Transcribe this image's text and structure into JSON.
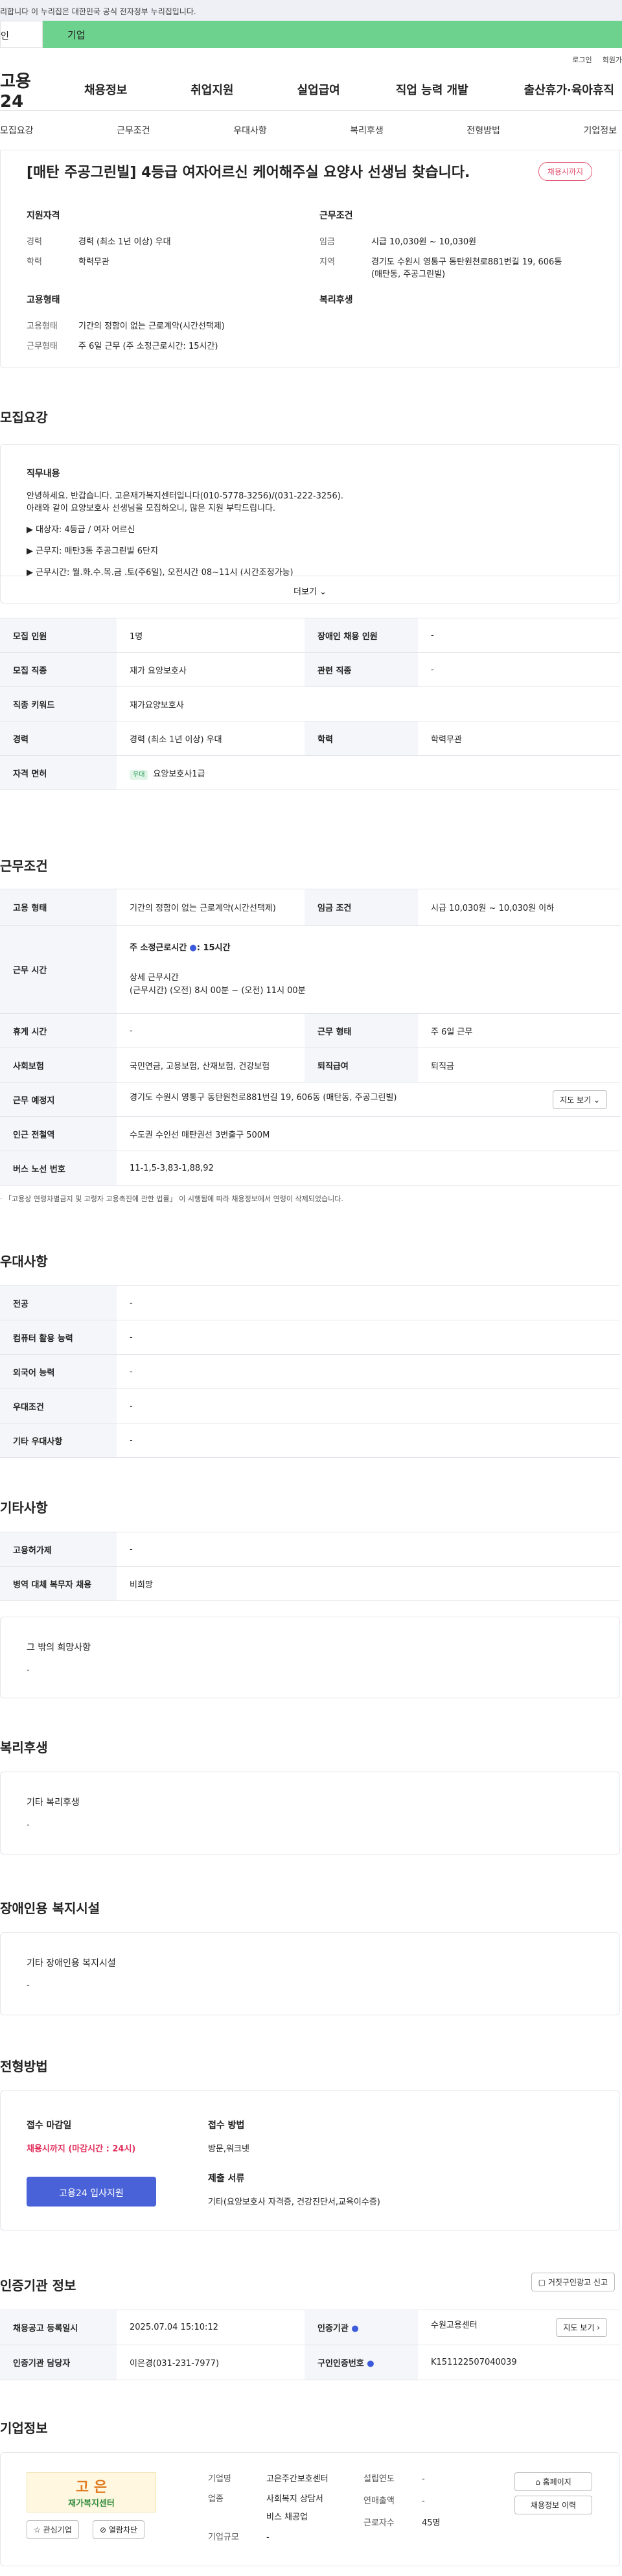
{
  "gov": "리합니다 이 누리집은 대한민국 공식 전자정부 누리집입니다.",
  "tabs": {
    "a": "인",
    "b": "기업"
  },
  "util": {
    "login": "로그인",
    "join": "회원가"
  },
  "logo": "고용24",
  "gnb": [
    "채용정보",
    "취업지원",
    "실업급여",
    "직업 능력 개발",
    "출산휴가·육아휴직"
  ],
  "snav": [
    "모집요강",
    "근무조건",
    "우대사항",
    "복리후생",
    "전형방법",
    "기업정보"
  ],
  "job": {
    "title": "[매탄 주공그린빌] 4등급 여자어르신 케어해주실 요양사 선생님 찾습니다.",
    "badge": "채용시까지",
    "qual_h": "지원자격",
    "exp_k": "경력",
    "exp_v": "경력 (최소 1년 이상) 우대",
    "edu_k": "학력",
    "edu_v": "학력무관",
    "cond_h": "근무조건",
    "wage_k": "임금",
    "wage_v": "시급 10,030원 ~ 10,030원",
    "area_k": "지역",
    "area_v1": "경기도 수원시 영통구 동탄원천로881번길 19, 606동",
    "area_v2": "(매탄동, 주공그린빌)",
    "emp_h": "고용형태",
    "type_k": "고용형태",
    "type_v": "기간의 정함이 없는 근로계약(시간선택제)",
    "form_k": "근무형태",
    "form_v": "주 6일 근무 (주 소정근로시간: 15시간)",
    "wel_h": "복리후생"
  },
  "s1": {
    "title": "모집요강",
    "duty_h": "직무내용",
    "l1": "안녕하세요. 반갑습니다.  고은재가복지센터입니다(010-5778-3256)/(031-222-3256).",
    "l2": "아래와 같이 요양보호사 선생님을 모집하오니, 많은 지원 부탁드립니다.",
    "l3": "▶ 대상자: 4등급 / 여자 어르신",
    "l4": "▶ 근무지: 매탄3동 주공그린빌 6단지",
    "l5": "▶ 근무시간: 월.화.수.목.금 .토(주6일), 오전시간 08~11시 (시간조정가능)",
    "more": "더보기",
    "cnt_k": "모집 인원",
    "cnt_v": "1명",
    "dis_k": "장애인 채용 인원",
    "dis_v": "-",
    "job_k": "모집 직종",
    "job_v": "재가 요양보호사",
    "rel_k": "관련 직종",
    "rel_v": "-",
    "kw_k": "직종 키워드",
    "kw_v": "재가요양보호사",
    "exp_k": "경력",
    "exp_v": "경력 (최소 1년 이상) 우대",
    "edu_k": "학력",
    "edu_v": "학력무관",
    "lic_k": "자격 면허",
    "lic_tag": "우대",
    "lic_v": "요양보호사1급"
  },
  "s2": {
    "title": "근무조건",
    "type_k": "고용 형태",
    "type_v": "기간의 정함이 없는 근로계약(시간선택제)",
    "wage_k": "임금 조건",
    "wage_v": "시급 10,030원 ~ 10,030원 이하",
    "time_k": "근무 시간",
    "time1": "주 소정근로시간",
    "time1b": ": 15시간",
    "time2": "상세 근무시간",
    "time3": "(근무시간) (오전) 8시 00분 ~ (오전) 11시 00분",
    "rest_k": "휴게 시간",
    "rest_v": "-",
    "form_k": "근무 형태",
    "form_v": "주 6일 근무",
    "ins_k": "사회보험",
    "ins_v": "국민연금, 고용보험, 산재보험, 건강보험",
    "ret_k": "퇴직급여",
    "ret_v": "퇴직금",
    "loc_k": "근무 예정지",
    "loc_v": "경기도 수원시 영통구 동탄원천로881번길 19, 606동 (매탄동, 주공그린빌)",
    "map": "지도 보기",
    "sub_k": "인근 전철역",
    "sub_v": "수도권 수인선 매탄권선 3번출구 500M",
    "bus_k": "버스 노선 번호",
    "bus_v": "11-1,5-3,83-1,88,92",
    "note": "· 「고용상 연령차별금지 및 고령자 고용촉진에 관한 법률」 이 시행됨에 따라 채용정보에서 연령이 삭제되었습니다."
  },
  "s3": {
    "title": "우대사항",
    "rows": [
      [
        "전공",
        "-"
      ],
      [
        "컴퓨터 활용 능력",
        "-"
      ],
      [
        "외국어 능력",
        "-"
      ],
      [
        "우대조건",
        "-"
      ],
      [
        "기타 우대사항",
        "-"
      ]
    ]
  },
  "s4": {
    "title": "기타사항",
    "r1k": "고용허가제",
    "r1v": "-",
    "r2k": "병역 대체 복무자 채용",
    "r2v": "비희망",
    "wish_h": "그 밖의 희망사항",
    "wish_v": "-"
  },
  "s5": {
    "title": "복리후생",
    "h": "기타 복리후생",
    "v": "-"
  },
  "s6": {
    "title": "장애인용 복지시설",
    "h": "기타 장애인용 복지시설",
    "v": "-"
  },
  "s7": {
    "title": "전형방법",
    "dl_h": "접수 마감일",
    "dl_v": "채용시까지 (마감시간 : 24시)",
    "apply": "고용24 입사지원",
    "m_h": "접수 방법",
    "m_v": "방문,워크넷",
    "d_h": "제출 서류",
    "d_v": "기타(요양보호사 자격증, 건강진단서,교육이수증)"
  },
  "s8": {
    "title": "인증기관 정보",
    "report": "거짓구인광고 신고",
    "reg_k": "채용공고 등록일시",
    "reg_v": "2025.07.04 15:10:12",
    "org_k": "인증기관",
    "org_v": "수원고용센터",
    "map": "지도 보기",
    "mgr_k": "인증기관 담당자",
    "mgr_v": "이은경(031-231-7977)",
    "no_k": "구인인증번호",
    "no_v": "K151122507040039"
  },
  "s9": {
    "title": "기업정보",
    "logo1": "고 은",
    "logo2": "재가복지센터",
    "fav": "관심기업",
    "block": "열람차단",
    "name_k": "기업명",
    "name_v": "고은주간보호센터",
    "ind_k": "업종",
    "ind_v1": "사회복지 상담서",
    "ind_v2": "비스 채공업",
    "size_k": "기업규모",
    "size_v": "-",
    "year_k": "설립연도",
    "year_v": "-",
    "sales_k": "연매출액",
    "sales_v": "-",
    "emp_k": "근로자수",
    "emp_v": "45명",
    "home": "홈페이지",
    "hist": "채용정보 이력"
  }
}
